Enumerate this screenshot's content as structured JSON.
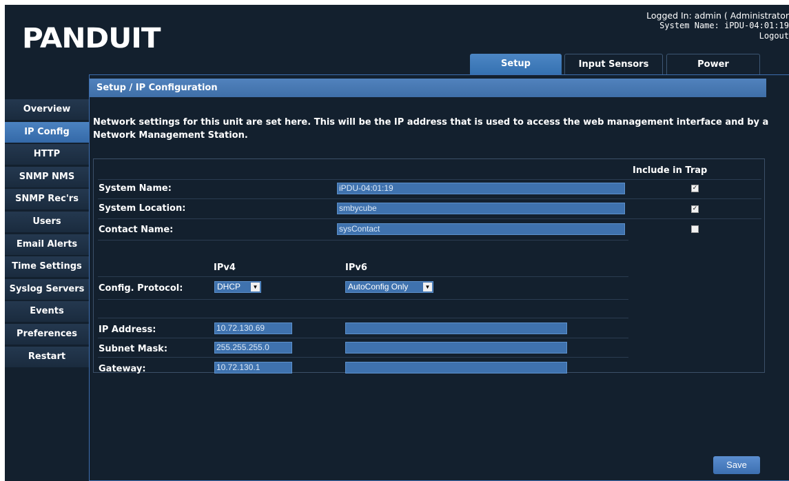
{
  "header": {
    "logo": "PANDUIT",
    "logged_in": "Logged In: admin ( Administrator",
    "system_name": "System Name: iPDU-04:01:19",
    "logout": "Logout"
  },
  "tabs": [
    {
      "label": "Setup",
      "active": true
    },
    {
      "label": "Input Sensors",
      "active": false
    },
    {
      "label": "Power",
      "active": false
    }
  ],
  "breadcrumb": "Setup / IP Configuration",
  "sidebar": {
    "items": [
      {
        "label": "Overview"
      },
      {
        "label": "IP Config",
        "active": true
      },
      {
        "label": "HTTP"
      },
      {
        "label": "SNMP NMS"
      },
      {
        "label": "SNMP Rec'rs"
      },
      {
        "label": "Users"
      },
      {
        "label": "Email Alerts"
      },
      {
        "label": "Time Settings"
      },
      {
        "label": "Syslog Servers"
      },
      {
        "label": "Events"
      },
      {
        "label": "Preferences"
      },
      {
        "label": "Restart"
      }
    ]
  },
  "description": "Network settings for this unit are set here. This will be the IP address that is used to access the web management interface and by a Network Management Station.",
  "form": {
    "include_in_trap_header": "Include in Trap",
    "system_name": {
      "label": "System Name:",
      "value": "iPDU-04:01:19",
      "trap": true
    },
    "system_location": {
      "label": "System Location:",
      "value": "smbycube",
      "trap": true
    },
    "contact_name": {
      "label": "Contact Name:",
      "value": "sysContact",
      "trap": false
    },
    "ipv4_header": "IPv4",
    "ipv6_header": "IPv6",
    "config_protocol": {
      "label": "Config. Protocol:",
      "ipv4": "DHCP",
      "ipv6": "AutoConfig Only"
    },
    "ip_address": {
      "label": "IP Address:",
      "ipv4": "10.72.130.69",
      "ipv6": ""
    },
    "subnet_mask": {
      "label": "Subnet Mask:",
      "ipv4": "255.255.255.0",
      "ipv6": ""
    },
    "gateway": {
      "label": "Gateway:",
      "ipv4": "10.72.130.1",
      "ipv6": ""
    }
  },
  "save_label": "Save",
  "icons": {
    "checkbox_checked": "check-icon",
    "dropdown": "chevron-down-icon"
  },
  "colors": {
    "background": "#13202e",
    "accent": "#3f72ae",
    "text": "#ffffff"
  }
}
